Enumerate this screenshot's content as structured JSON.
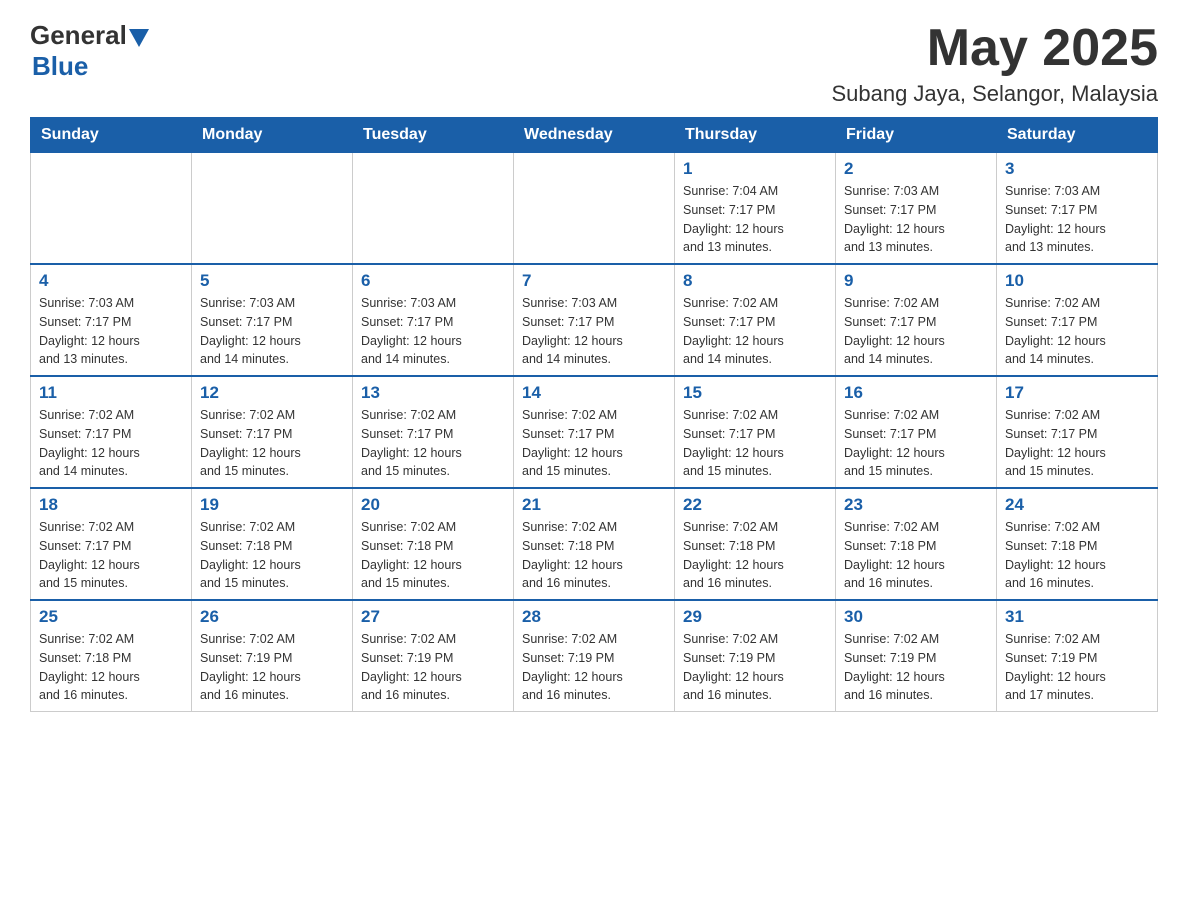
{
  "header": {
    "logo_general": "General",
    "logo_blue": "Blue",
    "month_title": "May 2025",
    "location": "Subang Jaya, Selangor, Malaysia"
  },
  "weekdays": [
    "Sunday",
    "Monday",
    "Tuesday",
    "Wednesday",
    "Thursday",
    "Friday",
    "Saturday"
  ],
  "weeks": [
    [
      {
        "day": "",
        "info": ""
      },
      {
        "day": "",
        "info": ""
      },
      {
        "day": "",
        "info": ""
      },
      {
        "day": "",
        "info": ""
      },
      {
        "day": "1",
        "info": "Sunrise: 7:04 AM\nSunset: 7:17 PM\nDaylight: 12 hours\nand 13 minutes."
      },
      {
        "day": "2",
        "info": "Sunrise: 7:03 AM\nSunset: 7:17 PM\nDaylight: 12 hours\nand 13 minutes."
      },
      {
        "day": "3",
        "info": "Sunrise: 7:03 AM\nSunset: 7:17 PM\nDaylight: 12 hours\nand 13 minutes."
      }
    ],
    [
      {
        "day": "4",
        "info": "Sunrise: 7:03 AM\nSunset: 7:17 PM\nDaylight: 12 hours\nand 13 minutes."
      },
      {
        "day": "5",
        "info": "Sunrise: 7:03 AM\nSunset: 7:17 PM\nDaylight: 12 hours\nand 14 minutes."
      },
      {
        "day": "6",
        "info": "Sunrise: 7:03 AM\nSunset: 7:17 PM\nDaylight: 12 hours\nand 14 minutes."
      },
      {
        "day": "7",
        "info": "Sunrise: 7:03 AM\nSunset: 7:17 PM\nDaylight: 12 hours\nand 14 minutes."
      },
      {
        "day": "8",
        "info": "Sunrise: 7:02 AM\nSunset: 7:17 PM\nDaylight: 12 hours\nand 14 minutes."
      },
      {
        "day": "9",
        "info": "Sunrise: 7:02 AM\nSunset: 7:17 PM\nDaylight: 12 hours\nand 14 minutes."
      },
      {
        "day": "10",
        "info": "Sunrise: 7:02 AM\nSunset: 7:17 PM\nDaylight: 12 hours\nand 14 minutes."
      }
    ],
    [
      {
        "day": "11",
        "info": "Sunrise: 7:02 AM\nSunset: 7:17 PM\nDaylight: 12 hours\nand 14 minutes."
      },
      {
        "day": "12",
        "info": "Sunrise: 7:02 AM\nSunset: 7:17 PM\nDaylight: 12 hours\nand 15 minutes."
      },
      {
        "day": "13",
        "info": "Sunrise: 7:02 AM\nSunset: 7:17 PM\nDaylight: 12 hours\nand 15 minutes."
      },
      {
        "day": "14",
        "info": "Sunrise: 7:02 AM\nSunset: 7:17 PM\nDaylight: 12 hours\nand 15 minutes."
      },
      {
        "day": "15",
        "info": "Sunrise: 7:02 AM\nSunset: 7:17 PM\nDaylight: 12 hours\nand 15 minutes."
      },
      {
        "day": "16",
        "info": "Sunrise: 7:02 AM\nSunset: 7:17 PM\nDaylight: 12 hours\nand 15 minutes."
      },
      {
        "day": "17",
        "info": "Sunrise: 7:02 AM\nSunset: 7:17 PM\nDaylight: 12 hours\nand 15 minutes."
      }
    ],
    [
      {
        "day": "18",
        "info": "Sunrise: 7:02 AM\nSunset: 7:17 PM\nDaylight: 12 hours\nand 15 minutes."
      },
      {
        "day": "19",
        "info": "Sunrise: 7:02 AM\nSunset: 7:18 PM\nDaylight: 12 hours\nand 15 minutes."
      },
      {
        "day": "20",
        "info": "Sunrise: 7:02 AM\nSunset: 7:18 PM\nDaylight: 12 hours\nand 15 minutes."
      },
      {
        "day": "21",
        "info": "Sunrise: 7:02 AM\nSunset: 7:18 PM\nDaylight: 12 hours\nand 16 minutes."
      },
      {
        "day": "22",
        "info": "Sunrise: 7:02 AM\nSunset: 7:18 PM\nDaylight: 12 hours\nand 16 minutes."
      },
      {
        "day": "23",
        "info": "Sunrise: 7:02 AM\nSunset: 7:18 PM\nDaylight: 12 hours\nand 16 minutes."
      },
      {
        "day": "24",
        "info": "Sunrise: 7:02 AM\nSunset: 7:18 PM\nDaylight: 12 hours\nand 16 minutes."
      }
    ],
    [
      {
        "day": "25",
        "info": "Sunrise: 7:02 AM\nSunset: 7:18 PM\nDaylight: 12 hours\nand 16 minutes."
      },
      {
        "day": "26",
        "info": "Sunrise: 7:02 AM\nSunset: 7:19 PM\nDaylight: 12 hours\nand 16 minutes."
      },
      {
        "day": "27",
        "info": "Sunrise: 7:02 AM\nSunset: 7:19 PM\nDaylight: 12 hours\nand 16 minutes."
      },
      {
        "day": "28",
        "info": "Sunrise: 7:02 AM\nSunset: 7:19 PM\nDaylight: 12 hours\nand 16 minutes."
      },
      {
        "day": "29",
        "info": "Sunrise: 7:02 AM\nSunset: 7:19 PM\nDaylight: 12 hours\nand 16 minutes."
      },
      {
        "day": "30",
        "info": "Sunrise: 7:02 AM\nSunset: 7:19 PM\nDaylight: 12 hours\nand 16 minutes."
      },
      {
        "day": "31",
        "info": "Sunrise: 7:02 AM\nSunset: 7:19 PM\nDaylight: 12 hours\nand 17 minutes."
      }
    ]
  ]
}
